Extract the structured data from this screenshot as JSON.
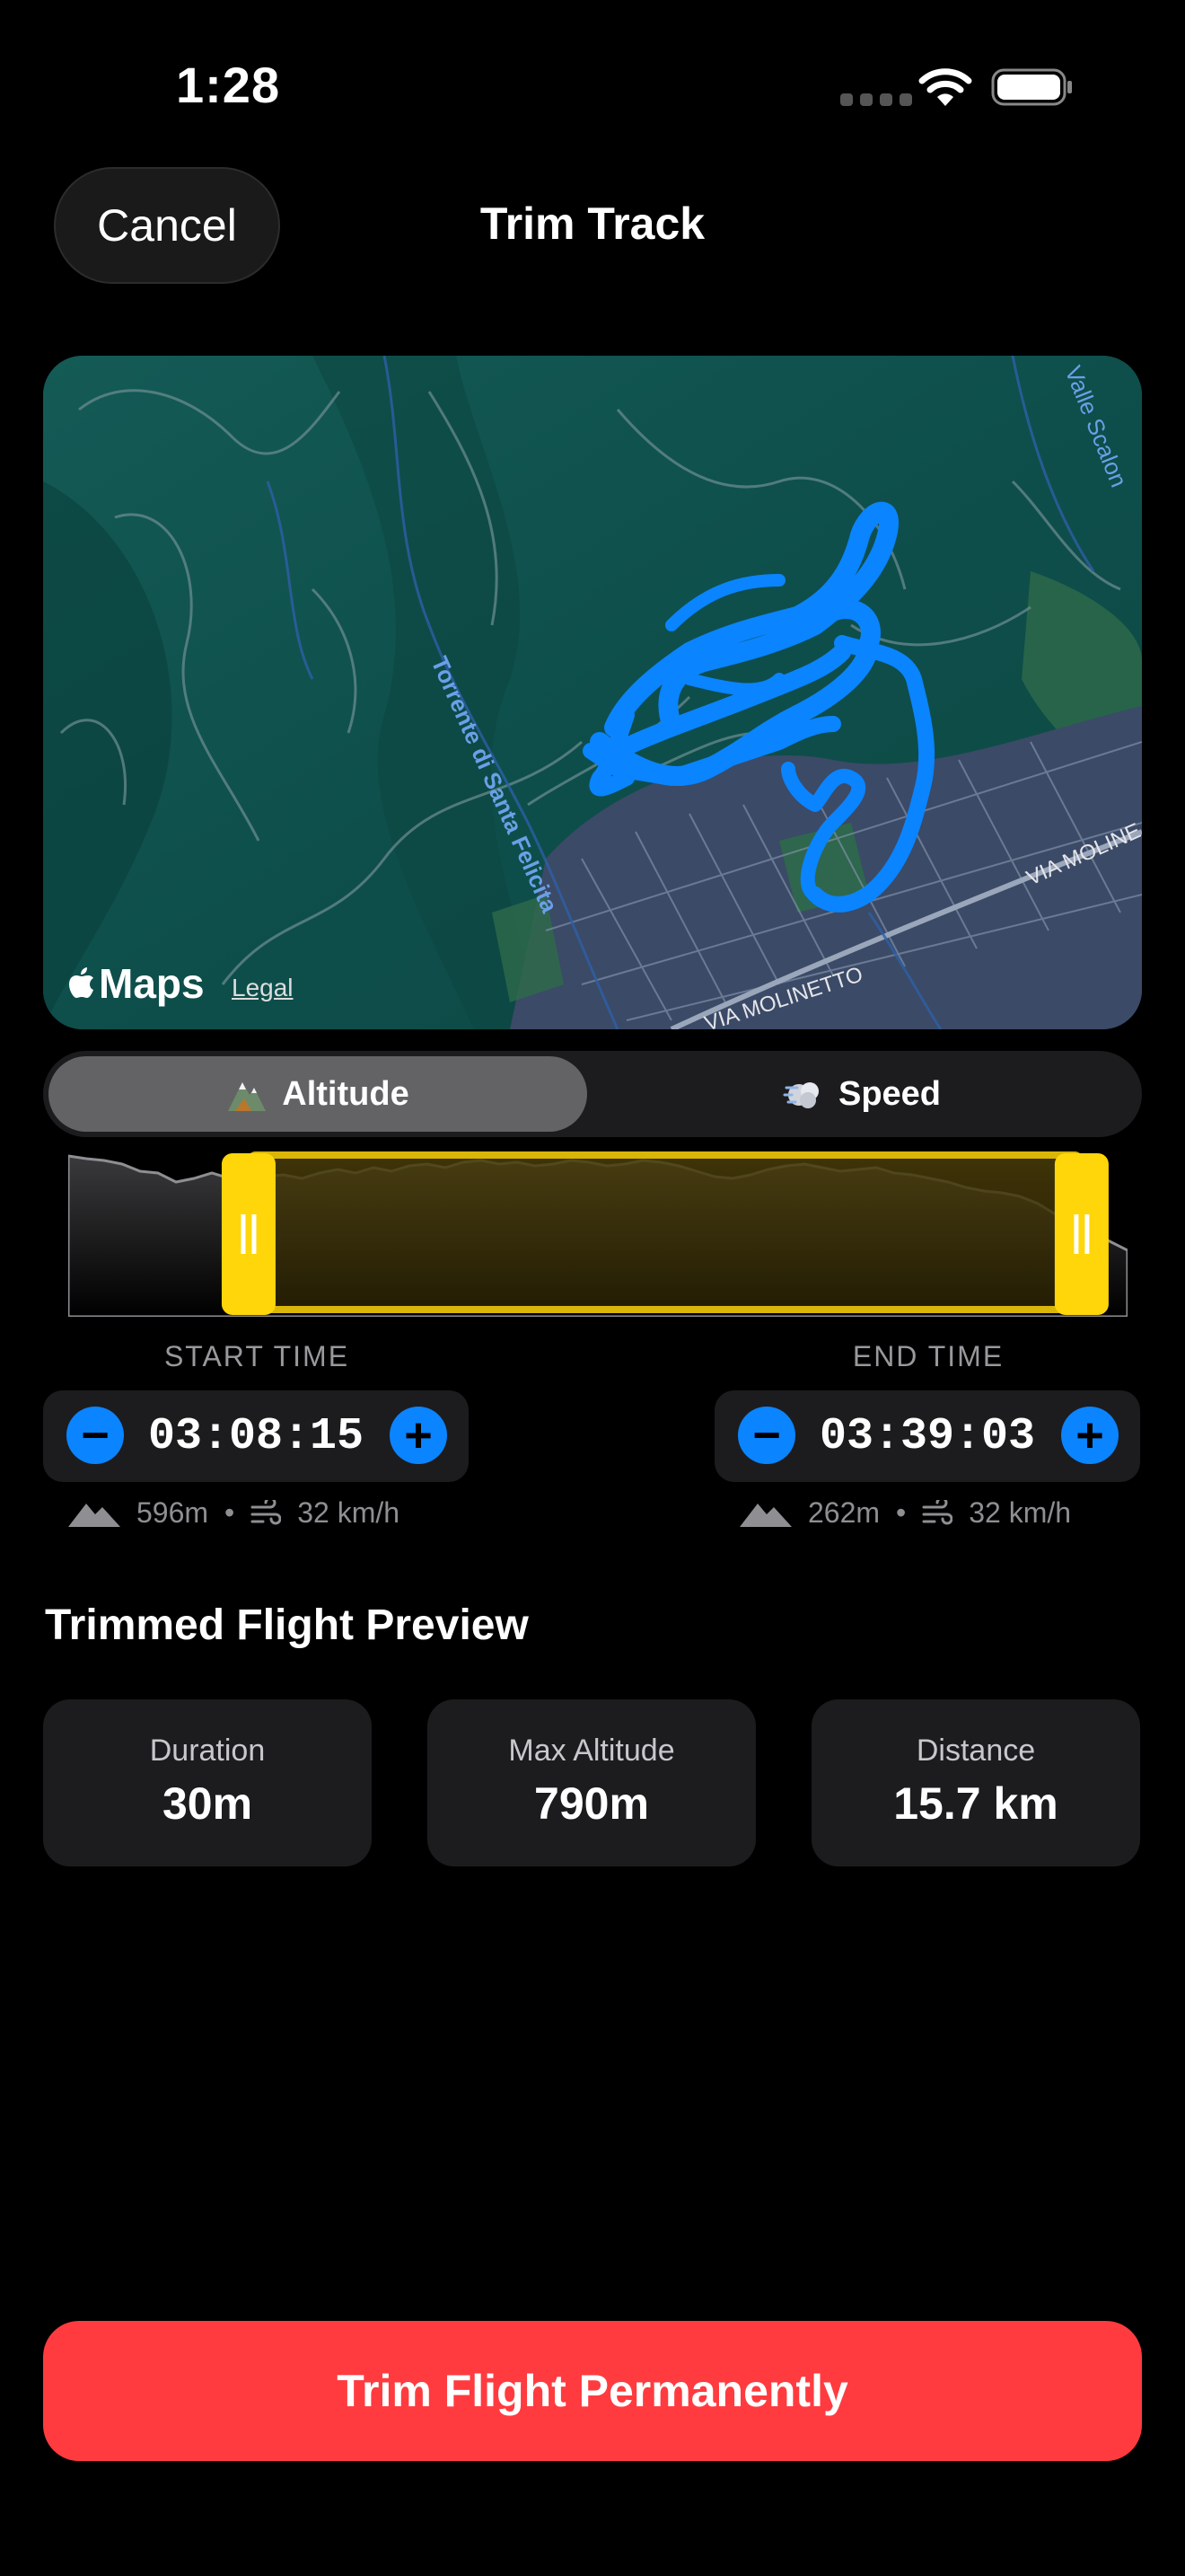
{
  "status": {
    "time": "1:28"
  },
  "nav": {
    "cancel_label": "Cancel",
    "title": "Trim Track"
  },
  "map": {
    "labels": [
      "Valle Scalon",
      "Torrente di Santa Felicita",
      "VIA MOLINETTO",
      "VIA MOLINE"
    ],
    "brand": "Maps",
    "legal": "Legal",
    "track_color": "#0a84ff"
  },
  "segment": {
    "altitude_label": "Altitude",
    "speed_label": "Speed",
    "selected": "Altitude"
  },
  "trim": {
    "start_fraction": 0.172,
    "end_fraction": 0.955
  },
  "start": {
    "label": "START TIME",
    "time": "03:08:15",
    "altitude": "596m",
    "speed": "32 km/h"
  },
  "end": {
    "label": "END TIME",
    "time": "03:39:03",
    "altitude": "262m",
    "speed": "32 km/h"
  },
  "preview": {
    "title": "Trimmed Flight Preview",
    "cards": [
      {
        "label": "Duration",
        "value": "30m"
      },
      {
        "label": "Max Altitude",
        "value": "790m"
      },
      {
        "label": "Distance",
        "value": "15.7 km"
      }
    ]
  },
  "action": {
    "trim_label": "Trim Flight Permanently",
    "color": "#ff3b3f"
  },
  "colors": {
    "accent": "#0a84ff",
    "handle": "#ffd60a"
  }
}
